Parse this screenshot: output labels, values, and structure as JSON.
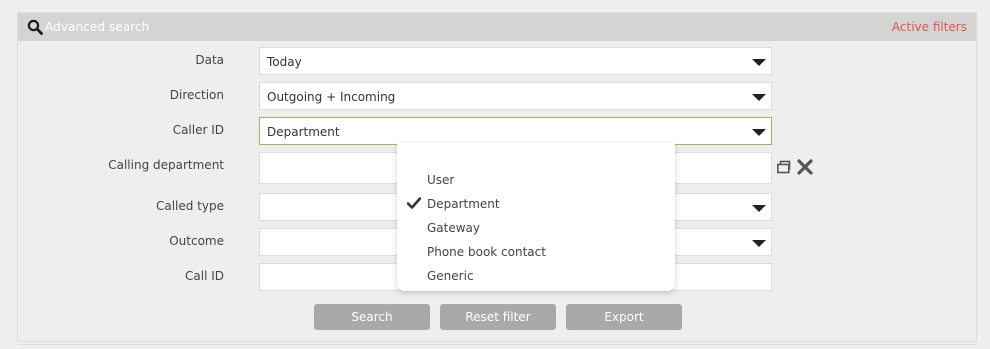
{
  "header": {
    "title": "Advanced search",
    "active_filters": "Active filters"
  },
  "form": {
    "data": {
      "label": "Data",
      "value": "Today"
    },
    "direction": {
      "label": "Direction",
      "value": "Outgoing + Incoming"
    },
    "caller_id": {
      "label": "Caller ID",
      "value": "Department"
    },
    "calling_department": {
      "label": "Calling department",
      "value": ""
    },
    "called_type": {
      "label": "Called type",
      "value": ""
    },
    "outcome": {
      "label": "Outcome",
      "value": ""
    },
    "call_id": {
      "label": "Call ID",
      "value": ""
    }
  },
  "dropdown": {
    "options": [
      "User",
      "Department",
      "Gateway",
      "Phone book contact",
      "Generic"
    ],
    "selected": "Department"
  },
  "buttons": {
    "search": "Search",
    "reset": "Reset filter",
    "export": "Export"
  },
  "colors": {
    "header_bg": "#d4d4d4",
    "active_filters": "#e0574f",
    "button_bg": "#a9a9a9",
    "focus_border": "#8cbf5a"
  }
}
